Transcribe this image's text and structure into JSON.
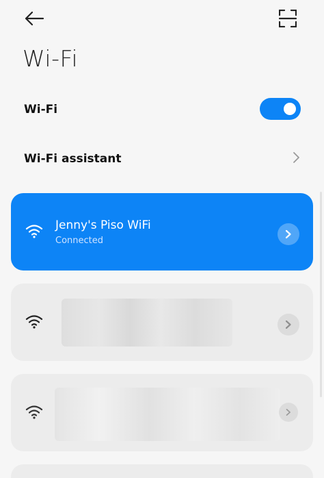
{
  "header": {
    "title": "Wi-Fi",
    "back_icon": "back-arrow-icon",
    "scan_icon": "qr-scan-icon"
  },
  "settings": {
    "wifi_label": "Wi-Fi",
    "wifi_enabled": true,
    "assistant_label": "Wi-Fi assistant"
  },
  "networks": {
    "connected": {
      "name": "Jenny's Piso WiFi",
      "status": "Connected"
    }
  },
  "colors": {
    "accent": "#0d84f6",
    "background": "#f6f6f6",
    "card": "#ececec"
  }
}
